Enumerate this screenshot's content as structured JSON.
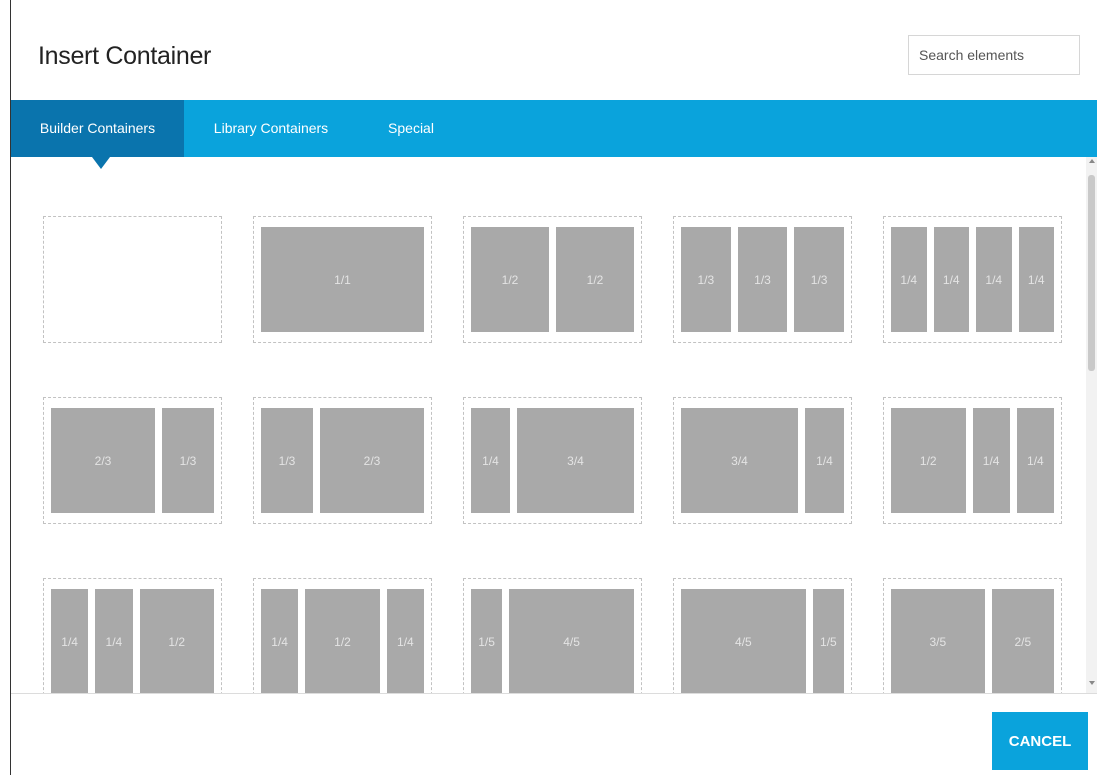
{
  "dialog": {
    "title": "Insert Container"
  },
  "search": {
    "placeholder": "Search elements",
    "value": ""
  },
  "tabs": [
    {
      "label": "Builder Containers",
      "active": true
    },
    {
      "label": "Library Containers",
      "active": false
    },
    {
      "label": "Special",
      "active": false
    }
  ],
  "containers": [
    {
      "name": "empty",
      "columns": []
    },
    {
      "name": "1-1",
      "columns": [
        {
          "label": "1/1",
          "fraction": 1
        }
      ]
    },
    {
      "name": "1-2-1-2",
      "columns": [
        {
          "label": "1/2",
          "fraction": 0.5
        },
        {
          "label": "1/2",
          "fraction": 0.5
        }
      ]
    },
    {
      "name": "1-3x3",
      "columns": [
        {
          "label": "1/3",
          "fraction": 0.3333
        },
        {
          "label": "1/3",
          "fraction": 0.3333
        },
        {
          "label": "1/3",
          "fraction": 0.3333
        }
      ]
    },
    {
      "name": "1-4x4",
      "columns": [
        {
          "label": "1/4",
          "fraction": 0.25
        },
        {
          "label": "1/4",
          "fraction": 0.25
        },
        {
          "label": "1/4",
          "fraction": 0.25
        },
        {
          "label": "1/4",
          "fraction": 0.25
        }
      ]
    },
    {
      "name": "2-3-1-3",
      "columns": [
        {
          "label": "2/3",
          "fraction": 0.6667
        },
        {
          "label": "1/3",
          "fraction": 0.3333
        }
      ]
    },
    {
      "name": "1-3-2-3",
      "columns": [
        {
          "label": "1/3",
          "fraction": 0.3333
        },
        {
          "label": "2/3",
          "fraction": 0.6667
        }
      ]
    },
    {
      "name": "1-4-3-4",
      "columns": [
        {
          "label": "1/4",
          "fraction": 0.25
        },
        {
          "label": "3/4",
          "fraction": 0.75
        }
      ]
    },
    {
      "name": "3-4-1-4",
      "columns": [
        {
          "label": "3/4",
          "fraction": 0.75
        },
        {
          "label": "1/4",
          "fraction": 0.25
        }
      ]
    },
    {
      "name": "1-2-1-4-1-4",
      "columns": [
        {
          "label": "1/2",
          "fraction": 0.5
        },
        {
          "label": "1/4",
          "fraction": 0.25
        },
        {
          "label": "1/4",
          "fraction": 0.25
        }
      ]
    },
    {
      "name": "1-4-1-4-1-2",
      "columns": [
        {
          "label": "1/4",
          "fraction": 0.25
        },
        {
          "label": "1/4",
          "fraction": 0.25
        },
        {
          "label": "1/2",
          "fraction": 0.5
        }
      ]
    },
    {
      "name": "1-4-1-2-1-4",
      "columns": [
        {
          "label": "1/4",
          "fraction": 0.25
        },
        {
          "label": "1/2",
          "fraction": 0.5
        },
        {
          "label": "1/4",
          "fraction": 0.25
        }
      ]
    },
    {
      "name": "1-5-4-5",
      "columns": [
        {
          "label": "1/5",
          "fraction": 0.2
        },
        {
          "label": "4/5",
          "fraction": 0.8
        }
      ]
    },
    {
      "name": "4-5-1-5",
      "columns": [
        {
          "label": "4/5",
          "fraction": 0.8
        },
        {
          "label": "1/5",
          "fraction": 0.2
        }
      ]
    },
    {
      "name": "3-5-2-5",
      "columns": [
        {
          "label": "3/5",
          "fraction": 0.6
        },
        {
          "label": "2/5",
          "fraction": 0.4
        }
      ]
    }
  ],
  "footer": {
    "cancel_label": "CANCEL"
  }
}
